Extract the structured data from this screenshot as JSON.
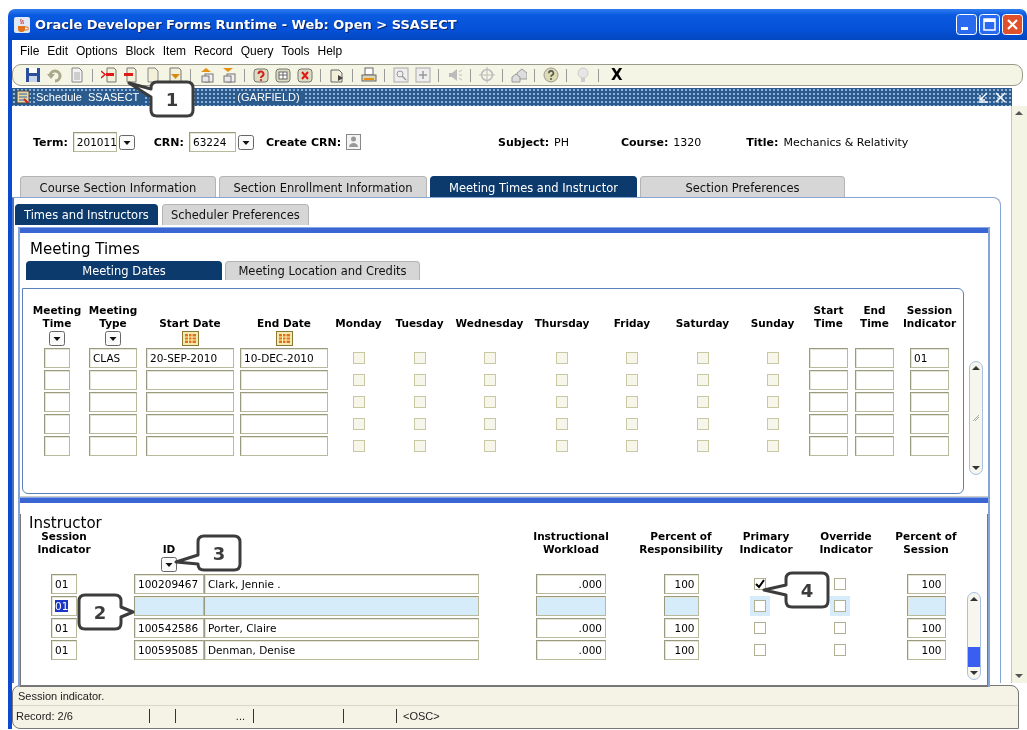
{
  "window": {
    "title": "Oracle Developer Forms Runtime - Web:  Open > SSASECT"
  },
  "menu": [
    "File",
    "Edit",
    "Options",
    "Block",
    "Item",
    "Record",
    "Query",
    "Tools",
    "Help"
  ],
  "toolbar": {
    "exit_label": "X"
  },
  "form": {
    "title": "Schedule  SSASECT",
    "title_tail": "(GARFIELD)"
  },
  "header": {
    "term": {
      "label": "Term:",
      "value": "201011"
    },
    "crn": {
      "label": "CRN:",
      "value": "63224"
    },
    "create_crn": {
      "label": "Create CRN:"
    },
    "subject": {
      "label": "Subject:",
      "value": "PH"
    },
    "course": {
      "label": "Course:",
      "value": "1320"
    },
    "title": {
      "label": "Title:",
      "value": "Mechanics & Relativity"
    }
  },
  "tabs": [
    {
      "label": "Course Section Information",
      "selected": false
    },
    {
      "label": "Section Enrollment Information",
      "selected": false
    },
    {
      "label": "Meeting Times and Instructor",
      "selected": true
    },
    {
      "label": "Section Preferences",
      "selected": false
    }
  ],
  "subtabs": [
    {
      "label": "Times and Instructors",
      "selected": true
    },
    {
      "label": "Scheduler Preferences",
      "selected": false
    }
  ],
  "meeting_times": {
    "title": "Meeting Times",
    "tabs": [
      {
        "label": "Meeting Dates",
        "selected": true
      },
      {
        "label": "Meeting Location and Credits",
        "selected": false
      }
    ],
    "columns": [
      {
        "label": "Meeting\nTime",
        "kind": "lov"
      },
      {
        "label": "Meeting\nType",
        "kind": "lov"
      },
      {
        "label": "Start Date",
        "kind": "date"
      },
      {
        "label": "End Date",
        "kind": "date"
      },
      {
        "label": "Monday",
        "kind": "day"
      },
      {
        "label": "Tuesday",
        "kind": "day"
      },
      {
        "label": "Wednesday",
        "kind": "day"
      },
      {
        "label": "Thursday",
        "kind": "day"
      },
      {
        "label": "Friday",
        "kind": "day"
      },
      {
        "label": "Saturday",
        "kind": "day"
      },
      {
        "label": "Sunday",
        "kind": "day"
      },
      {
        "label": "Start\nTime",
        "kind": "field"
      },
      {
        "label": "End\nTime",
        "kind": "field"
      },
      {
        "label": "Session\nIndicator",
        "kind": "field"
      }
    ],
    "rows": [
      {
        "meeting_type": "CLAS",
        "start_date": "20-SEP-2010",
        "end_date": "10-DEC-2010",
        "session": "01",
        "days": [
          false,
          false,
          false,
          false,
          false,
          false,
          false
        ]
      },
      {
        "days": [
          false,
          false,
          false,
          false,
          false,
          false,
          false
        ]
      },
      {
        "days": [
          false,
          false,
          false,
          false,
          false,
          false,
          false
        ]
      },
      {
        "days": [
          false,
          false,
          false,
          false,
          false,
          false,
          false
        ]
      },
      {
        "days": [
          false,
          false,
          false,
          false,
          false,
          false,
          false
        ]
      }
    ]
  },
  "instructor": {
    "title": "Instructor",
    "columns": [
      {
        "label": "Session\nIndicator",
        "kind": "field"
      },
      {
        "label": "ID",
        "kind": "lov"
      },
      {
        "label": "Instructional\nWorkload",
        "kind": "field"
      },
      {
        "label": "Percent of\nResponsibility",
        "kind": "field"
      },
      {
        "label": "Primary\nIndicator",
        "kind": "check"
      },
      {
        "label": "Override\nIndicator",
        "kind": "check"
      },
      {
        "label": "Percent of\nSession",
        "kind": "field"
      }
    ],
    "rows": [
      {
        "session": "01",
        "id": "100209467",
        "name": "Clark, Jennie  .",
        "workload": ".000",
        "responsibility": "100",
        "primary": true,
        "override": false,
        "percent_session": "100",
        "selected": false
      },
      {
        "session": "01",
        "primary": false,
        "override": false,
        "selected": true
      },
      {
        "session": "01",
        "id": "100542586",
        "name": "Porter, Claire",
        "workload": ".000",
        "responsibility": "100",
        "primary": false,
        "override": false,
        "percent_session": "100",
        "selected": false
      },
      {
        "session": "01",
        "id": "100595085",
        "name": "Denman, Denise",
        "workload": ".000",
        "responsibility": "100",
        "primary": false,
        "override": false,
        "percent_session": "100",
        "selected": false
      }
    ]
  },
  "status_bar": {
    "message": "Session indicator.",
    "record": "Record: 2/6",
    "cell_3": "...",
    "cell_5": "<OSC>"
  },
  "callouts": [
    {
      "label": "1"
    },
    {
      "label": "2"
    },
    {
      "label": "3"
    },
    {
      "label": "4"
    }
  ]
}
